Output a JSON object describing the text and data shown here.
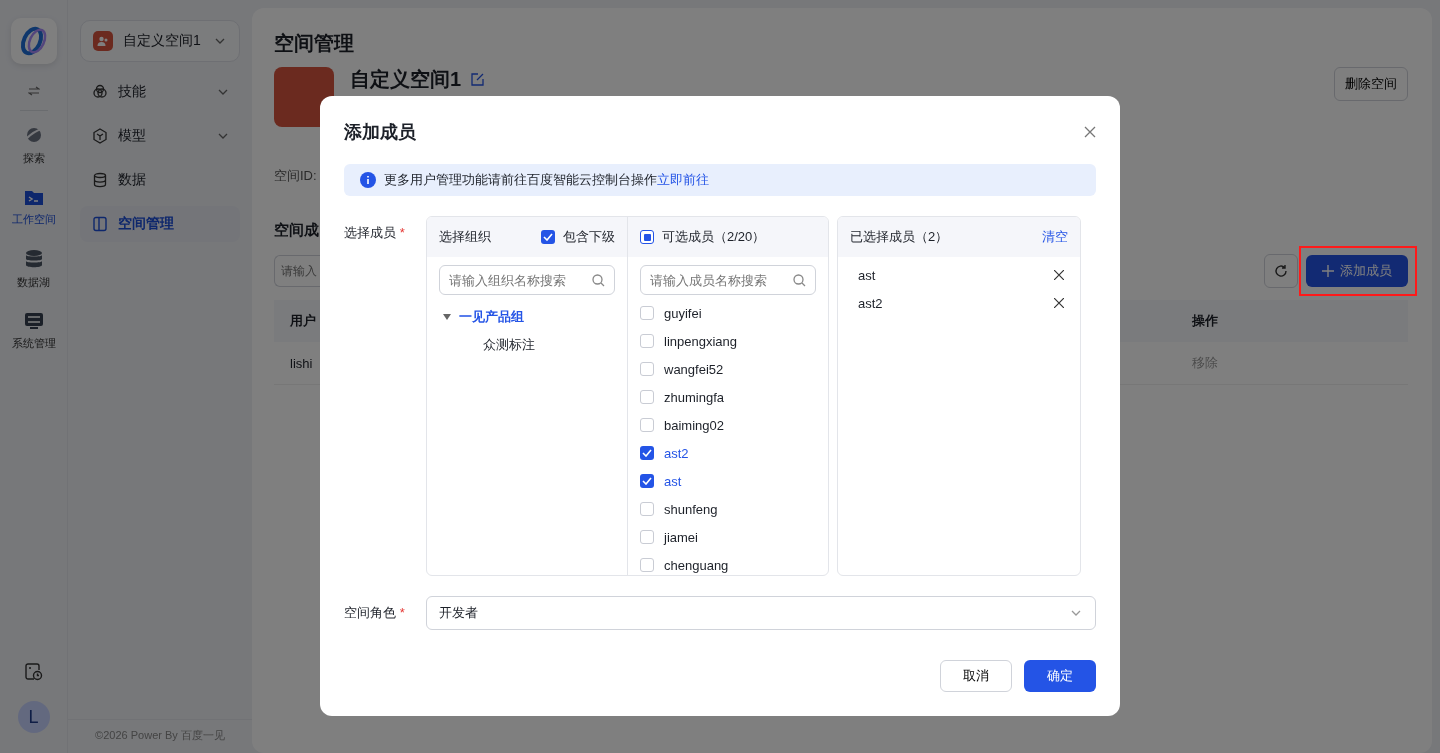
{
  "rail": {
    "items": [
      {
        "label": "探索",
        "kind": "planet",
        "selected": false
      },
      {
        "label": "工作空间",
        "kind": "folder",
        "selected": true
      },
      {
        "label": "数据湖",
        "kind": "database",
        "selected": false
      },
      {
        "label": "系统管理",
        "kind": "monitor",
        "selected": false
      }
    ],
    "avatar": "L"
  },
  "sidebar": {
    "space_selector": {
      "label": "自定义空间1"
    },
    "items": [
      {
        "label": "技能",
        "kind": "skill",
        "expandable": true,
        "selected": false
      },
      {
        "label": "模型",
        "kind": "model",
        "expandable": true,
        "selected": false
      },
      {
        "label": "数据",
        "kind": "data",
        "expandable": false,
        "selected": false
      },
      {
        "label": "空间管理",
        "kind": "space",
        "expandable": false,
        "selected": true
      }
    ],
    "footer": "©2026 Power By 百度一见"
  },
  "page": {
    "title": "空间管理",
    "space_name": "自定义空间1",
    "delete_button": "删除空间",
    "space_id_label": "空间ID:",
    "section_title": "空间成",
    "search": {
      "placeholder": "请输入"
    },
    "add_button": {
      "label": "添加成员",
      "highlighted": true
    },
    "table": {
      "columns": [
        "用户",
        "操作"
      ],
      "rows": [
        {
          "cells": [
            "lishi",
            "移除"
          ]
        }
      ]
    }
  },
  "dialog": {
    "title": "添加成员",
    "notice": "更多用户管理功能请前往百度智能云控制台操作",
    "notice_link": "立即前往",
    "members_label": "选择成员",
    "members_required": "*",
    "org": {
      "title": "选择组织",
      "include_children": {
        "label": "包含下级",
        "checked": true
      },
      "search": {
        "placeholder": "请输入组织名称搜索"
      },
      "tree": [
        {
          "label": "一见产品组",
          "expanded": true,
          "selected": true,
          "children": [
            {
              "label": "众测标注",
              "selected": false
            }
          ]
        }
      ]
    },
    "candidates": {
      "title": "可选成员（2/20）",
      "indeterminate": true,
      "search": {
        "placeholder": "请输入成员名称搜索"
      },
      "items": [
        {
          "label": "guyifei",
          "checked": false
        },
        {
          "label": "linpengxiang",
          "checked": false
        },
        {
          "label": "wangfei52",
          "checked": false
        },
        {
          "label": "zhumingfa",
          "checked": false
        },
        {
          "label": "baiming02",
          "checked": false
        },
        {
          "label": "ast2",
          "checked": true
        },
        {
          "label": "ast",
          "checked": true
        },
        {
          "label": "shunfeng",
          "checked": false
        },
        {
          "label": "jiamei",
          "checked": false
        },
        {
          "label": "chenguang",
          "checked": false
        }
      ]
    },
    "selected": {
      "title": "已选择成员（2）",
      "clear": "清空",
      "items": [
        "ast",
        "ast2"
      ]
    },
    "role_label": "空间角色",
    "role_required": "*",
    "role": {
      "value": "开发者"
    },
    "cancel": "取消",
    "ok": "确定"
  }
}
